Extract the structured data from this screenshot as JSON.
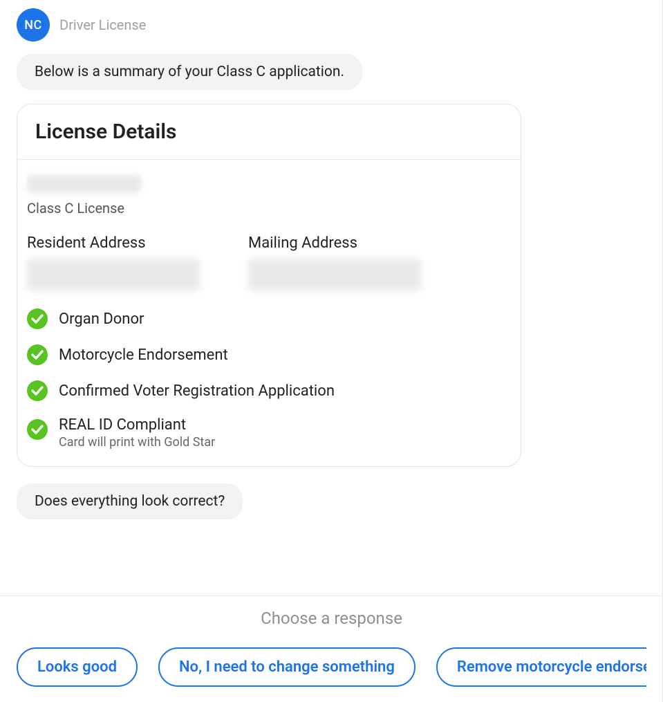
{
  "header": {
    "avatar_initials": "NC",
    "title": "Driver License"
  },
  "messages": {
    "intro": "Below is a summary of your Class C application.",
    "confirm": "Does everything look correct?"
  },
  "card": {
    "title": "License Details",
    "license_type": "Class C License",
    "resident_label": "Resident Address",
    "mailing_label": "Mailing Address",
    "features": [
      {
        "label": "Organ Donor",
        "sub": null
      },
      {
        "label": "Motorcycle Endorsement",
        "sub": null
      },
      {
        "label": "Confirmed Voter Registration Application",
        "sub": null
      },
      {
        "label": "REAL ID Compliant",
        "sub": "Card will print with Gold Star"
      }
    ]
  },
  "response": {
    "prompt": "Choose a response",
    "buttons": [
      "Looks good",
      "No, I need to change something",
      "Remove motorcycle endorsement"
    ]
  },
  "colors": {
    "accent": "#1d73e8",
    "check": "#58c322"
  }
}
